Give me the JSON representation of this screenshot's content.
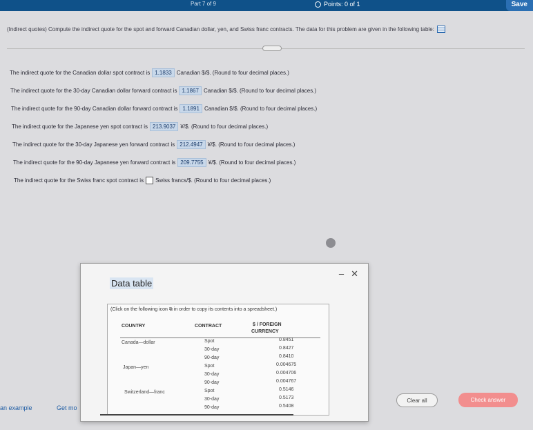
{
  "header": {
    "part": "Part 7 of 9",
    "points": "Points: 0 of 1",
    "save": "Save"
  },
  "question": "(Indirect quotes) Compute the indirect quote for the spot and forward Canadian dollar, yen, and Swiss franc contracts. The data for this problem are given in the following table:",
  "answers": [
    {
      "pre": "The indirect quote for the Canadian dollar spot contract is",
      "value": "1.1833",
      "post": "Canadian $/$. (Round to four decimal places.)"
    },
    {
      "pre": "The indirect quote for the 30-day Canadian dollar forward contract is",
      "value": "1.1867",
      "post": "Canadian $/$. (Round to four decimal places.)"
    },
    {
      "pre": "The indirect quote for the 90-day Canadian dollar forward contract is",
      "value": "1.1891",
      "post": "Canadian $/$. (Round to four decimal places.)"
    },
    {
      "pre": "The indirect quote for the Japanese yen spot contract is",
      "value": "213.9037",
      "post": "¥/$. (Round to four decimal places.)"
    },
    {
      "pre": "The indirect quote for the 30-day Japanese yen forward contract is",
      "value": "212.4947",
      "post": "¥/$. (Round to four decimal places.)"
    },
    {
      "pre": "The indirect quote for the 90-day Japanese yen forward contract is",
      "value": "209.7755",
      "post": "¥/$. (Round to four decimal places.)"
    },
    {
      "pre": "The indirect quote for the Swiss franc spot contract is",
      "value": "",
      "post": "Swiss francs/$. (Round to four decimal places.)"
    }
  ],
  "modal": {
    "title": "Data table",
    "copy_note": "(Click on the following icon ⧉ in order to copy its contents into a spreadsheet.)",
    "minimize": "–",
    "close": "✕",
    "headers": {
      "country": "COUNTRY",
      "contract": "CONTRACT",
      "rate_line1": "$ / FOREIGN",
      "rate_line2": "CURRENCY"
    },
    "countries": [
      "Canada—dollar",
      "Japan—yen",
      "Switzerland—franc"
    ],
    "contracts": [
      "Spot",
      "30-day",
      "90-day",
      "Spot",
      "30-day",
      "90-day",
      "Spot",
      "30-day",
      "90-day"
    ],
    "rates": [
      "0.8451",
      "0.8427",
      "0.8410",
      "0.004675",
      "0.004706",
      "0.004767",
      "0.5146",
      "0.5173",
      "0.5408"
    ]
  },
  "footer": {
    "example": "an example",
    "get_more": "Get mo",
    "clear_all": "Clear all",
    "check_answer": "Check answer"
  }
}
